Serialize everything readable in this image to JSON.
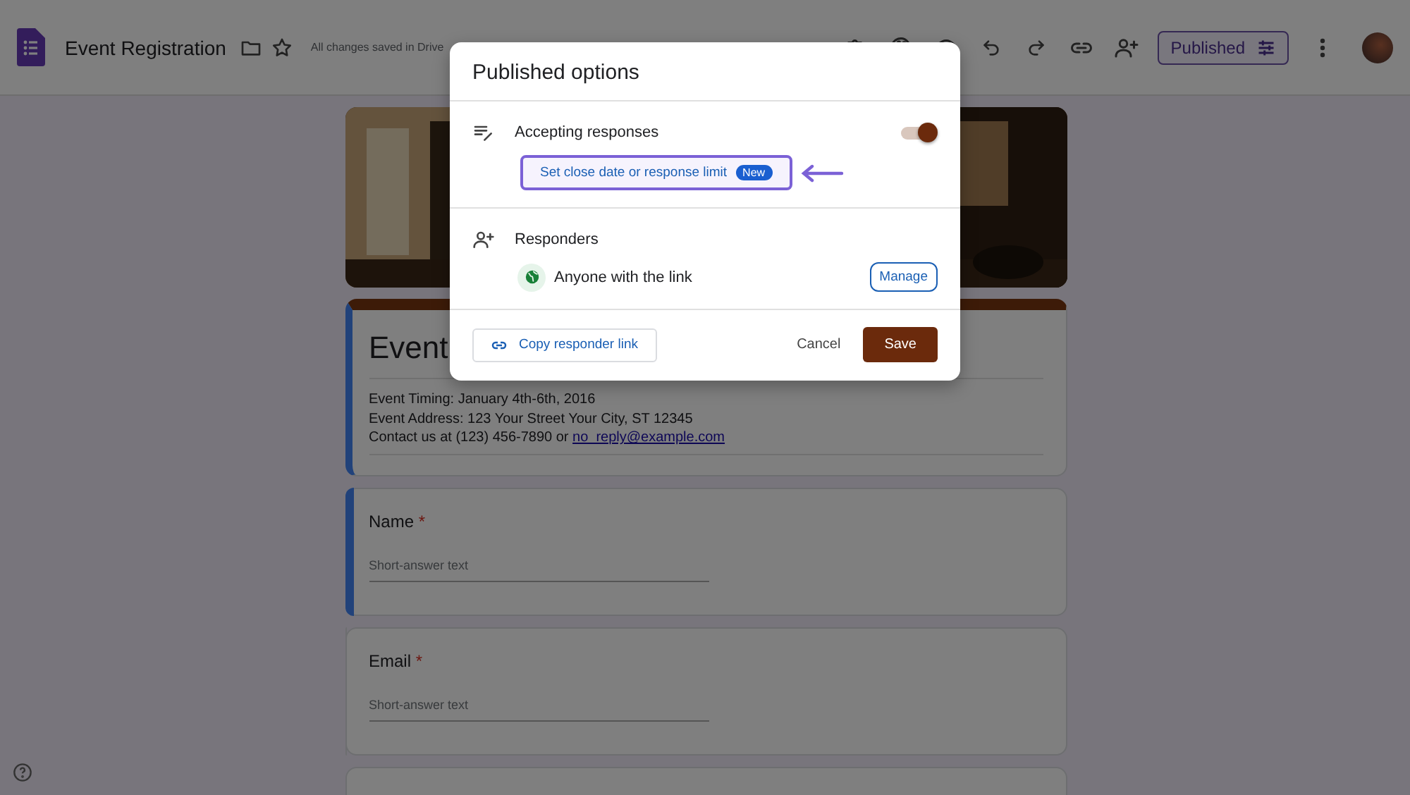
{
  "app_bar": {
    "title": "Event Registration",
    "save_status": "All changes saved in Drive",
    "publish_button": "Published"
  },
  "form": {
    "title": "Event",
    "selected": true,
    "description": [
      "Event Timing: January 4th-6th, 2016",
      "Event Address: 123 Your Street Your City, ST 12345"
    ],
    "contact": {
      "text": "Contact us at (123) 456-7890 or ",
      "link": "no_reply@example.com"
    },
    "questions": [
      {
        "label": "Name",
        "required_mark": "*",
        "placeholder": "Short-answer text",
        "selected": true
      },
      {
        "label": "Email",
        "required_mark": "*",
        "placeholder": "Short-answer text",
        "selected": false
      }
    ]
  },
  "dialog": {
    "title": "Published options",
    "sections": [
      {
        "kind": "accepting",
        "title": "Accepting responses",
        "on": true,
        "link": "Set close date or response limit",
        "badge": "New",
        "highlighted": true
      },
      {
        "kind": "responders",
        "title": "Responders",
        "access": "Anyone with the link",
        "button": "Manage"
      }
    ],
    "copy_button": "Copy responder link",
    "cancel_button": "Cancel",
    "save_button": "Save"
  }
}
